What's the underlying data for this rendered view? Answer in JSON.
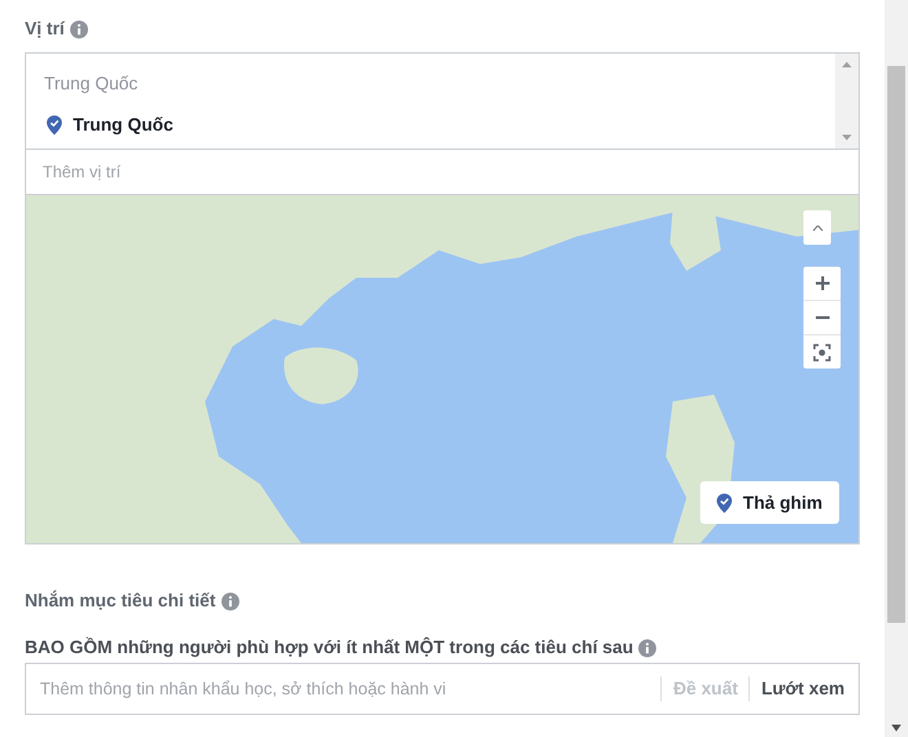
{
  "location": {
    "label": "Vị trí",
    "group_title": "Trung Quốc",
    "selected_locations": [
      {
        "name": "Trung Quốc"
      }
    ],
    "placeholder": "Thêm vị trí",
    "map": {
      "drop_pin_button": "Thả ghim"
    }
  },
  "detailed_targeting": {
    "label": "Nhắm mục tiêu chi tiết",
    "include_label": "BAO GỒM những người phù hợp với ít nhất MỘT trong các tiêu chí sau",
    "placeholder": "Thêm thông tin nhân khẩu học, sở thích hoặc hành vi",
    "actions": [
      {
        "label": "Đề xuất",
        "disabled": true
      },
      {
        "label": "Lướt xem",
        "disabled": false
      }
    ]
  }
}
